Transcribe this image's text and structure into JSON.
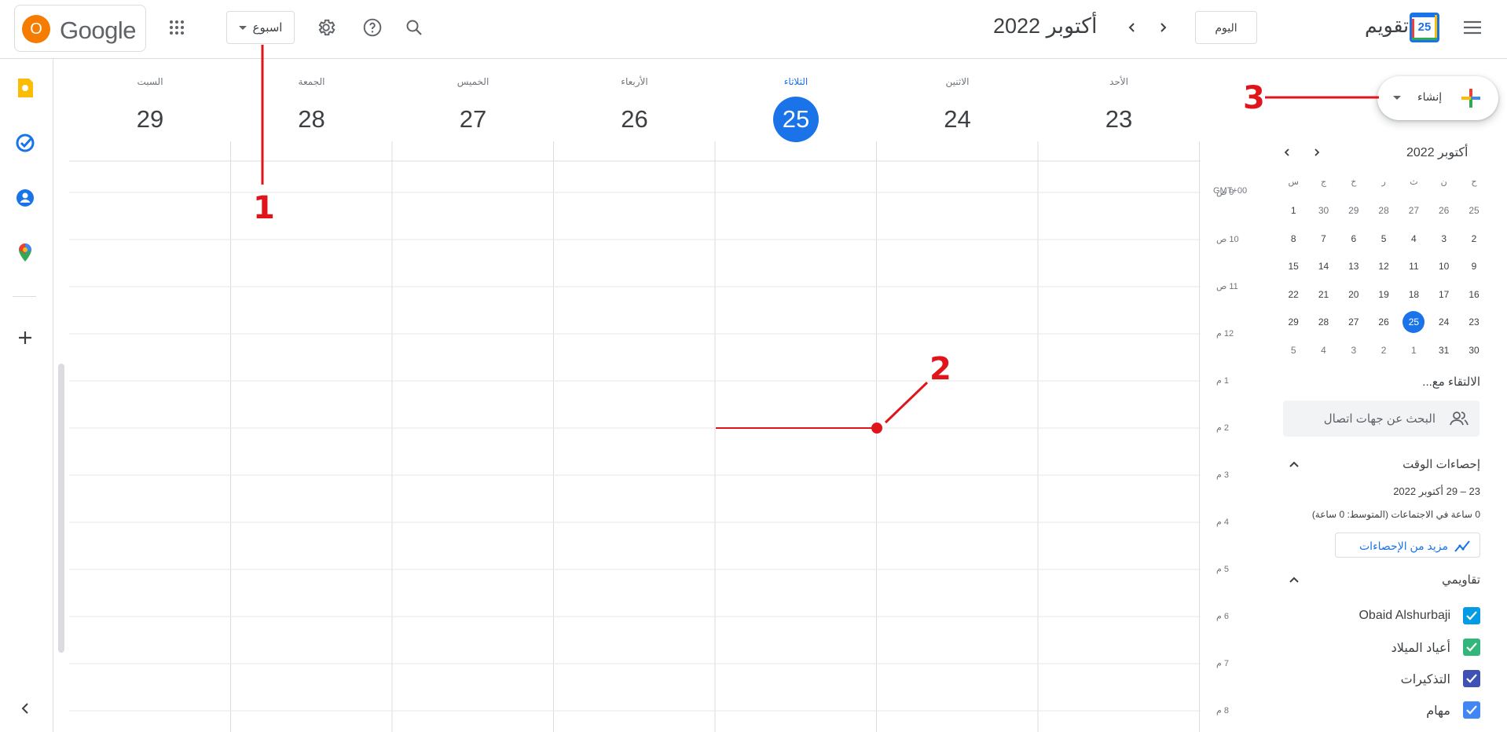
{
  "header": {
    "account_initial": "O",
    "google_logo": "Google",
    "view_label": "اسبوع",
    "month_title": "أكتوبر 2022",
    "today_label": "اليوم",
    "app_title": "تقويم",
    "app_logo_day": "25"
  },
  "week": {
    "days": [
      {
        "name": "السبت",
        "num": "29"
      },
      {
        "name": "الجمعة",
        "num": "28"
      },
      {
        "name": "الخميس",
        "num": "27"
      },
      {
        "name": "الأربعاء",
        "num": "26"
      },
      {
        "name": "الثلاثاء",
        "num": "25",
        "today": true
      },
      {
        "name": "الاثنين",
        "num": "24"
      },
      {
        "name": "الأحد",
        "num": "23"
      }
    ],
    "timezone": "GMT+00",
    "hours": [
      "9 ص",
      "10 ص",
      "11 ص",
      "12 م",
      "1 م",
      "2 م",
      "3 م",
      "4 م",
      "5 م",
      "6 م",
      "7 م",
      "8 م"
    ]
  },
  "create": {
    "label": "إنشاء"
  },
  "mini_calendar": {
    "title": "أكتوبر 2022",
    "dow": [
      "ح",
      "ن",
      "ث",
      "ر",
      "خ",
      "ج",
      "س"
    ],
    "weeks": [
      [
        "25",
        "26",
        "27",
        "28",
        "29",
        "30",
        "1"
      ],
      [
        "2",
        "3",
        "4",
        "5",
        "6",
        "7",
        "8"
      ],
      [
        "9",
        "10",
        "11",
        "12",
        "13",
        "14",
        "15"
      ],
      [
        "16",
        "17",
        "18",
        "19",
        "20",
        "21",
        "22"
      ],
      [
        "23",
        "24",
        "25",
        "26",
        "27",
        "28",
        "29"
      ],
      [
        "30",
        "31",
        "1",
        "2",
        "3",
        "4",
        "5"
      ]
    ],
    "today": "25"
  },
  "meet": {
    "title": "الالتقاء مع...",
    "search_placeholder": "البحث عن جهات اتصال"
  },
  "time_insights": {
    "title": "إحصاءات الوقت",
    "range": "23 – 29 أكتوبر 2022",
    "summary": "0 ساعة في الاجتماعات (المتوسط: 0 ساعة)",
    "more_button": "مزيد من الإحصاءات"
  },
  "my_calendars": {
    "title": "تقاويمي",
    "items": [
      {
        "label": "Obaid Alshurbaji",
        "color": "#039be5"
      },
      {
        "label": "أعياد الميلاد",
        "color": "#33b679"
      },
      {
        "label": "التذكيرات",
        "color": "#3f51b5"
      },
      {
        "label": "مهام",
        "color": "#4285f4"
      }
    ]
  },
  "annotations": {
    "one": "1",
    "two": "2",
    "three": "3"
  },
  "colors": {
    "accent": "#1a73e8",
    "annotation_red": "#e0151b",
    "avatar_orange": "#f57c00"
  }
}
